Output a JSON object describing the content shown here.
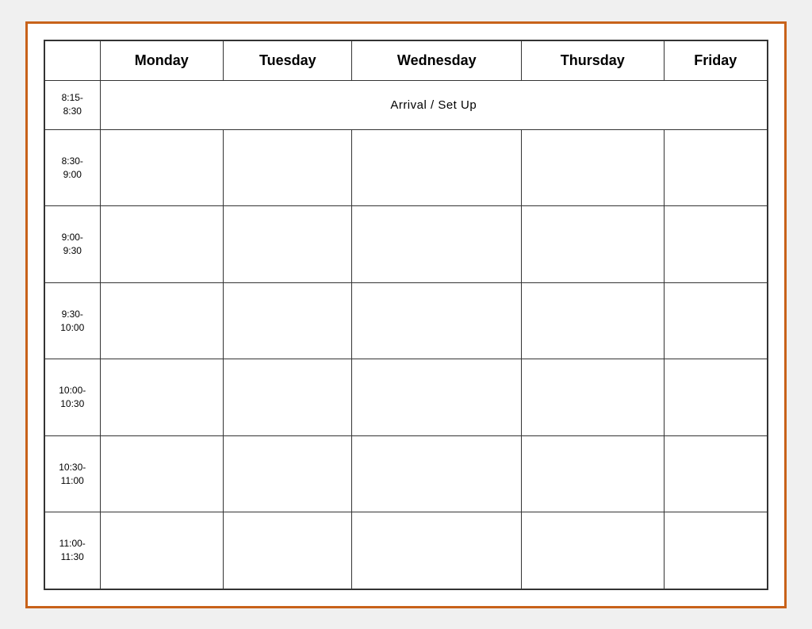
{
  "table": {
    "headers": {
      "time_col": "",
      "monday": "Monday",
      "tuesday": "Tuesday",
      "wednesday": "Wednesday",
      "thursday": "Thursday",
      "friday": "Friday"
    },
    "rows": [
      {
        "time": "8:15-\n8:30",
        "arrival_text": "Arrival / Set Up",
        "span": 5
      },
      {
        "time": "8:30-\n9:00"
      },
      {
        "time": "9:00-\n9:30"
      },
      {
        "time": "9:30-\n10:00"
      },
      {
        "time": "10:00-\n10:30"
      },
      {
        "time": "10:30-\n11:00"
      },
      {
        "time": "11:00-\n11:30"
      }
    ]
  }
}
